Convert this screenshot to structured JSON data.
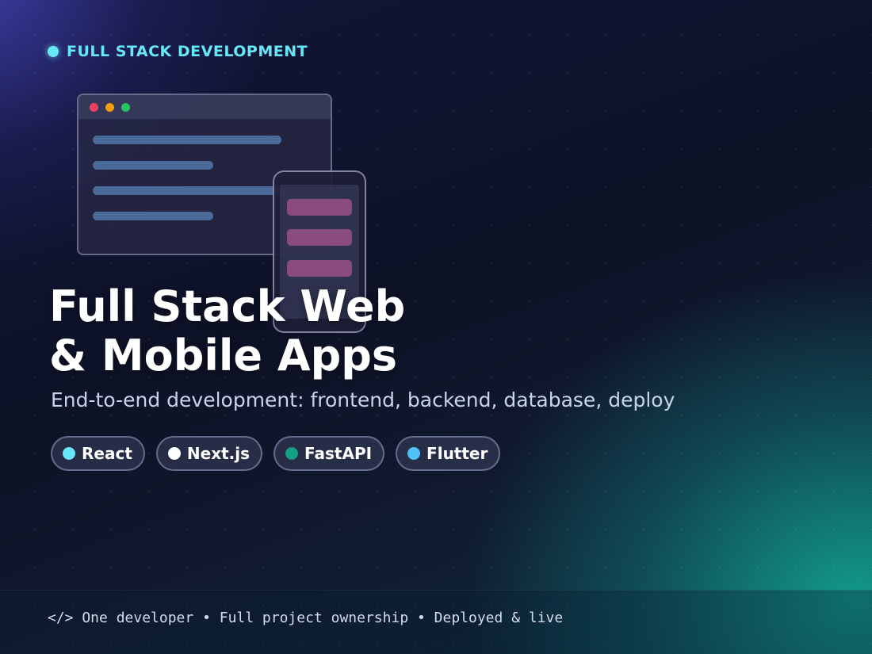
{
  "eyebrow": {
    "label": "FULL STACK DEVELOPMENT",
    "dot_color": "#67e8f9"
  },
  "illustration": {
    "browser_window": {
      "traffic_lights": [
        "#f43f5e",
        "#f59e0b",
        "#22c55e"
      ],
      "code_line_color": "#4a6a9a"
    },
    "phone": {
      "block_color": "#8a4c7e"
    }
  },
  "hero": {
    "title_line1": "Full Stack Web",
    "title_line2": "& Mobile Apps",
    "subtitle": "End-to-end development: frontend, backend, database, deploy"
  },
  "tech_chips": [
    {
      "label": "React",
      "color": "#67e8f9"
    },
    {
      "label": "Next.js",
      "color": "#ffffff"
    },
    {
      "label": "FastAPI",
      "color": "#14a085"
    },
    {
      "label": "Flutter",
      "color": "#4fc3f7"
    }
  ],
  "footer": {
    "text": "</> One developer • Full project ownership • Deployed & live"
  }
}
